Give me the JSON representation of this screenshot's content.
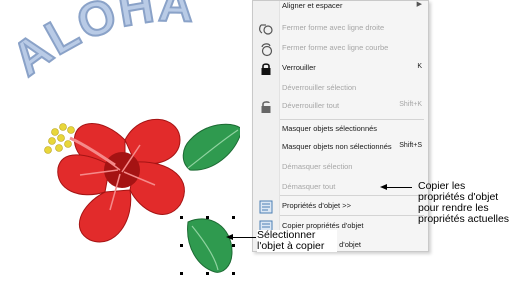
{
  "artwork": {
    "title_text": "ALOHA",
    "colors": {
      "aloha_fill": "#b9cbe6",
      "aloha_stroke": "#8aa2c8",
      "flower_red": "#e22b2b",
      "flower_dark": "#a51313",
      "flower_light": "#f58a8a",
      "stamen_yellow": "#e8d63a",
      "leaf_green": "#2f9a4f",
      "leaf_dark": "#1c6a33",
      "leaf_vein": "#8fd3a0"
    }
  },
  "context_menu": {
    "items": [
      {
        "label": "Aligner et espacer",
        "shortcut": "",
        "disabled": false,
        "submenu": true,
        "icon": ""
      },
      {
        "label": "Fermer forme avec ligne droite",
        "shortcut": "",
        "disabled": true,
        "submenu": false,
        "icon": "close-straight-icon"
      },
      {
        "label": "Fermer forme avec ligne courbe",
        "shortcut": "",
        "disabled": true,
        "submenu": false,
        "icon": "close-curve-icon"
      },
      {
        "label": "Verrouiller",
        "shortcut": "K",
        "disabled": false,
        "submenu": false,
        "icon": "lock-icon"
      },
      {
        "label": "Déverrouiller sélection",
        "shortcut": "",
        "disabled": true,
        "submenu": false,
        "icon": ""
      },
      {
        "label": "Déverrouiller tout",
        "shortcut": "Shift+K",
        "disabled": true,
        "submenu": false,
        "icon": "unlock-icon"
      },
      {
        "label": "Masquer objets sélectionnés",
        "shortcut": "",
        "disabled": false,
        "submenu": false,
        "icon": ""
      },
      {
        "label": "Masquer objets non sélectionnés",
        "shortcut": "Shift+S",
        "disabled": false,
        "submenu": false,
        "icon": ""
      },
      {
        "label": "Démasquer sélection",
        "shortcut": "",
        "disabled": true,
        "submenu": false,
        "icon": ""
      },
      {
        "label": "Démasquer tout",
        "shortcut": "",
        "disabled": true,
        "submenu": false,
        "icon": ""
      },
      {
        "label": "Propriétés d'objet >>",
        "shortcut": "",
        "disabled": false,
        "submenu": false,
        "icon": "properties-icon"
      },
      {
        "label": "Copier propriétés d'objet",
        "shortcut": "",
        "disabled": false,
        "submenu": false,
        "icon": "copy-properties-icon"
      },
      {
        "label": "Coller propriétés d'objet",
        "shortcut": "",
        "disabled": false,
        "submenu": false,
        "icon": ""
      }
    ]
  },
  "callouts": {
    "copy_props": [
      "Copier les",
      "propriétés d'objet",
      "pour rendre les",
      "propriétés actuelles"
    ],
    "select_object": [
      "Sélectionner",
      "l'objet à copier"
    ]
  }
}
